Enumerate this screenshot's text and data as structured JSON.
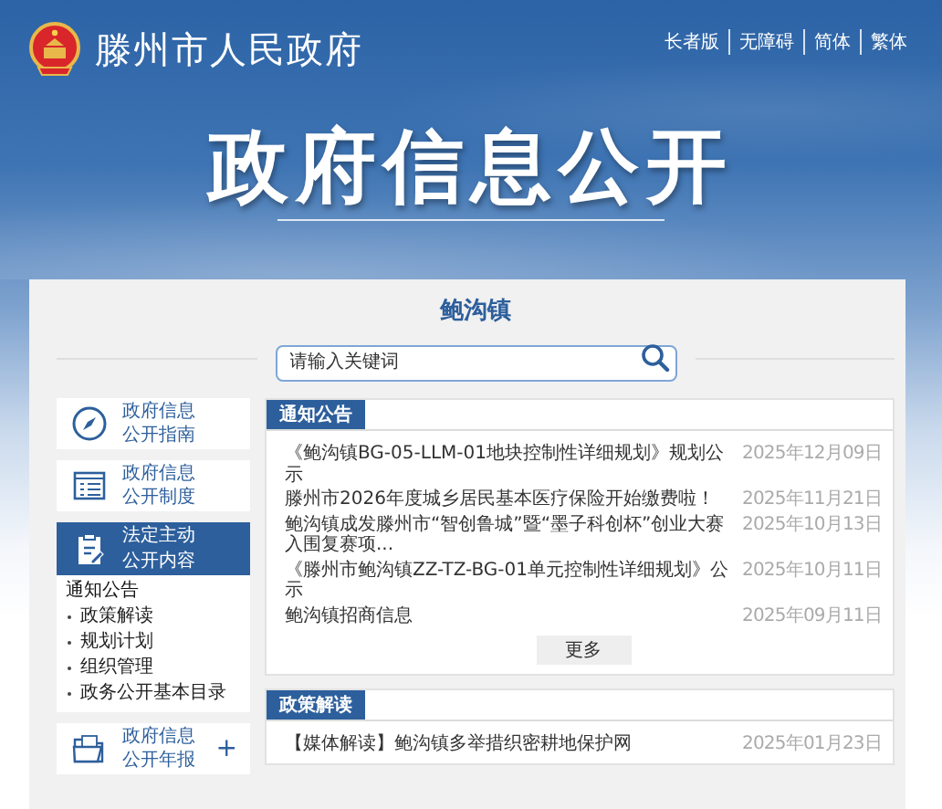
{
  "header": {
    "site_name": "滕州市人民政府",
    "links": [
      {
        "label": "长者版"
      },
      {
        "label": "无障碍"
      },
      {
        "label": "简体"
      },
      {
        "label": "繁体"
      }
    ],
    "banner_title": "政府信息公开"
  },
  "town": {
    "title": "鲍沟镇"
  },
  "search": {
    "placeholder": "请输入关键词"
  },
  "sidebar": {
    "items": [
      {
        "kind": "compass",
        "label_lines": [
          "政府信息",
          "公开指南"
        ],
        "selected": false
      },
      {
        "kind": "list",
        "label_lines": [
          "政府信息",
          "公开制度"
        ],
        "selected": false
      },
      {
        "kind": "clipboard",
        "label_lines": [
          "法定主动",
          "公开内容"
        ],
        "selected": true,
        "expanded": true,
        "children": [
          {
            "label": "通知公告",
            "selected": true
          },
          {
            "label": "政策解读",
            "selected": false
          },
          {
            "label": "规划计划",
            "selected": false
          },
          {
            "label": "组织管理",
            "selected": false
          },
          {
            "label": "政务公开基本目录",
            "selected": false
          }
        ]
      },
      {
        "kind": "folder",
        "label_lines": [
          "政府信息",
          "公开年报"
        ],
        "selected": false,
        "expand_symbol": "+"
      }
    ]
  },
  "sections": [
    {
      "title": "通知公告",
      "items": [
        {
          "title": "《鲍沟镇BG-05-LLM-01地块控制性详细规划》规划公示",
          "date": "2025年12月09日"
        },
        {
          "title": "滕州市2026年度城乡居民基本医疗保险开始缴费啦！",
          "date": "2025年11月21日"
        },
        {
          "title": "鲍沟镇成发滕州市“智创鲁城”暨“墨子科创杯”创业大赛入围复赛项...",
          "date": "2025年10月13日"
        },
        {
          "title": "《滕州市鲍沟镇ZZ-TZ-BG-01单元控制性详细规划》公示",
          "date": "2025年10月11日"
        },
        {
          "title": "鲍沟镇招商信息",
          "date": "2025年09月11日"
        }
      ],
      "more": "更多"
    },
    {
      "title": "政策解读",
      "items": [
        {
          "title": "【媒体解读】鲍沟镇多举措织密耕地保护网",
          "date": "2025年01月23日"
        }
      ]
    }
  ]
}
